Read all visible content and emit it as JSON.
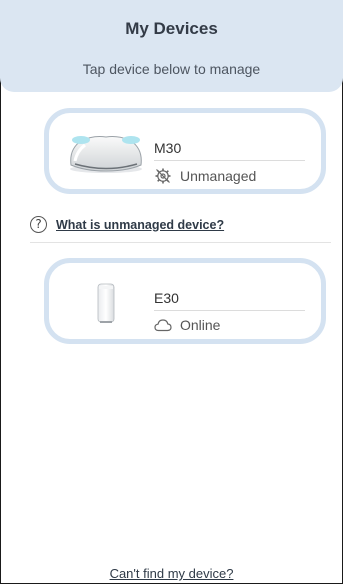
{
  "header": {
    "title": "My Devices",
    "subtitle": "Tap device below to manage"
  },
  "devices": [
    {
      "name": "M30",
      "status": "Unmanaged",
      "status_icon": "unmanaged-gear-icon"
    },
    {
      "name": "E30",
      "status": "Online",
      "status_icon": "cloud-icon"
    }
  ],
  "help": {
    "icon": "?",
    "link_text": "What is unmanaged device?"
  },
  "footer": {
    "link_text": "Can't find my device?"
  },
  "colors": {
    "header_bg": "#dbe6f2",
    "card_border": "#d4e2f1"
  }
}
